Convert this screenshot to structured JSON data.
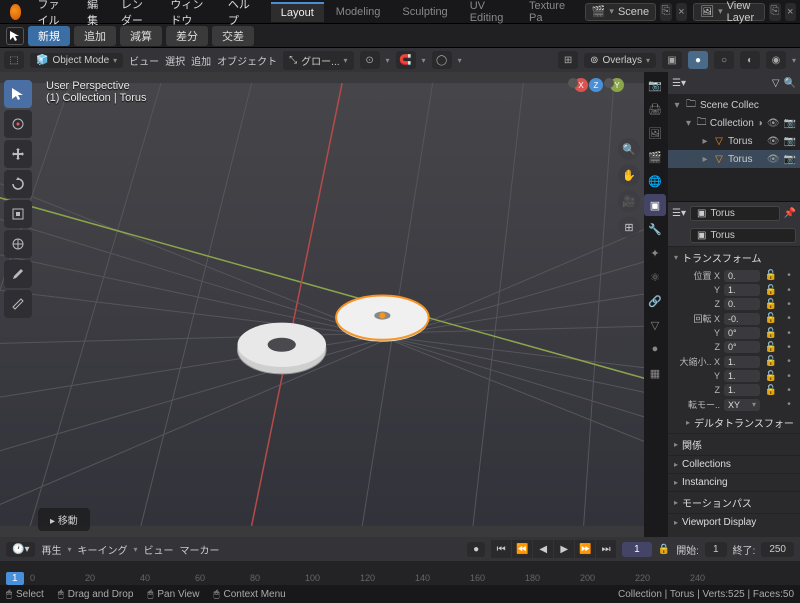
{
  "top": {
    "menus": [
      "ファイル",
      "編集",
      "レンダー",
      "ウィンドウ",
      "ヘルプ"
    ],
    "workspaces": [
      "Layout",
      "Modeling",
      "Sculpting",
      "UV Editing",
      "Texture Pa"
    ],
    "scene_label": "Scene",
    "viewlayer_label": "View Layer"
  },
  "wsrow": {
    "new": "新規",
    "items": [
      "追加",
      "減算",
      "差分",
      "交差"
    ]
  },
  "vh": {
    "mode": "Object Mode",
    "menus": [
      "ビュー",
      "選択",
      "追加",
      "オブジェクト"
    ],
    "global": "グロー...",
    "overlays": "Overlays"
  },
  "overlay": {
    "line1": "User Perspective",
    "line2": "(1) Collection | Torus"
  },
  "outliner": {
    "root": "Scene Collec",
    "collection": "Collection",
    "obj1": "Torus",
    "obj2": "Torus"
  },
  "props": {
    "context": "Torus",
    "name": "Torus",
    "transform_hd": "トランスフォーム",
    "loc_label": "位置",
    "rot_label": "回転",
    "scale_label": "大縮小..",
    "rotmode_label": "転モー..",
    "rotmode_val": "XY",
    "delta_hd": "デルタトランスフォー",
    "loc": {
      "X": "0.",
      "Y": "1.",
      "Z": "0."
    },
    "rot": {
      "X": "-0.",
      "Y": "0°",
      "Z": "0°"
    },
    "scale": {
      "X": "1.",
      "Y": "1.",
      "Z": "1."
    },
    "panels": [
      "関係",
      "Collections",
      "Instancing",
      "モーションパス",
      "Viewport Display"
    ]
  },
  "timeline": {
    "menus": [
      "再生",
      "キーイング",
      "ビュー",
      "マーカー"
    ],
    "frame": "1",
    "start_lbl": "開始:",
    "start": "1",
    "end_lbl": "終了:",
    "end": "250",
    "ticks": [
      "0",
      "20",
      "40",
      "60",
      "80",
      "100",
      "120",
      "140",
      "160",
      "180",
      "200",
      "220",
      "240"
    ]
  },
  "status": {
    "select": "Select",
    "drag": "Drag and Drop",
    "pan": "Pan View",
    "ctx": "Context Menu",
    "info": "Collection | Torus | Verts:525 | Faces:50"
  },
  "move_popup": "移動"
}
